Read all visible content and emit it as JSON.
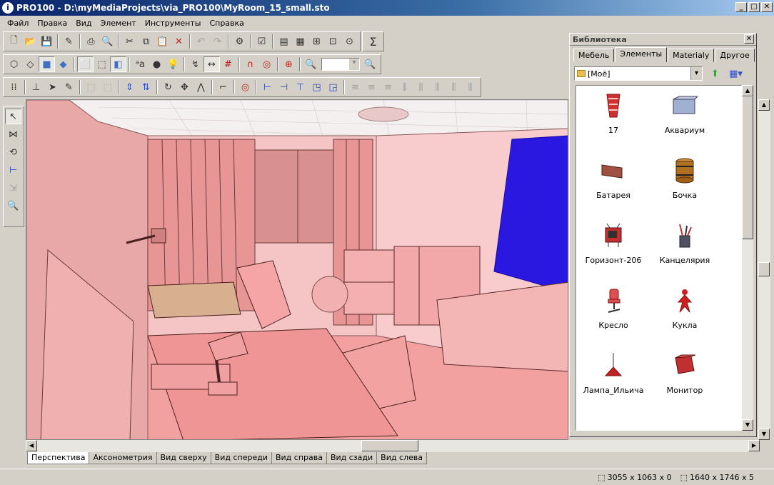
{
  "window": {
    "title": "PRO100 - D:\\myMediaProjects\\via_PRO100\\MyRoom_15_small.sto",
    "app_icon_glyph": "i",
    "minimize": "_",
    "maximize": "□",
    "close": "✕"
  },
  "menu": [
    "Файл",
    "Правка",
    "Вид",
    "Элемент",
    "Инструменты",
    "Справка"
  ],
  "library": {
    "title": "Библиотека",
    "close": "✕",
    "tabs": [
      "Мебель",
      "Элементы",
      "Materialy",
      "Другое"
    ],
    "active_tab": "Элементы",
    "folder": "[Моё]",
    "items": [
      {
        "label": "17",
        "icon": "vase-icon",
        "color": "#d03030"
      },
      {
        "label": "Аквариум",
        "icon": "aquarium-icon",
        "color": "#8090b0"
      },
      {
        "label": "Батарея",
        "icon": "radiator-icon",
        "color": "#a05040"
      },
      {
        "label": "Бочка",
        "icon": "barrel-icon",
        "color": "#b07020"
      },
      {
        "label": "Горизонт-206",
        "icon": "tv-icon",
        "color": "#c03030"
      },
      {
        "label": "Канцелярия",
        "icon": "stationery-icon",
        "color": "#505060"
      },
      {
        "label": "Кресло",
        "icon": "chair-icon",
        "color": "#e05050"
      },
      {
        "label": "Кукла",
        "icon": "doll-icon",
        "color": "#d02020"
      },
      {
        "label": "Лампа_Ильича",
        "icon": "lamp-icon",
        "color": "#c02020"
      },
      {
        "label": "Монитор",
        "icon": "monitor-icon",
        "color": "#c03030"
      }
    ]
  },
  "view_tabs": [
    "Перспектива",
    "Аксонометрия",
    "Вид сверху",
    "Вид спереди",
    "Вид справа",
    "Вид сзади",
    "Вид слева"
  ],
  "active_view": "Перспектива",
  "status": {
    "dimensions": "3055 x 1063 x 0",
    "size": "1640 x 1746 x 5"
  },
  "colors": {
    "scene_background": "#f4c9c9",
    "wall": "#f2b8b8",
    "furniture": "#f08f8f",
    "window_blue": "#2a18e0",
    "ceiling": "#f4f0f0"
  }
}
